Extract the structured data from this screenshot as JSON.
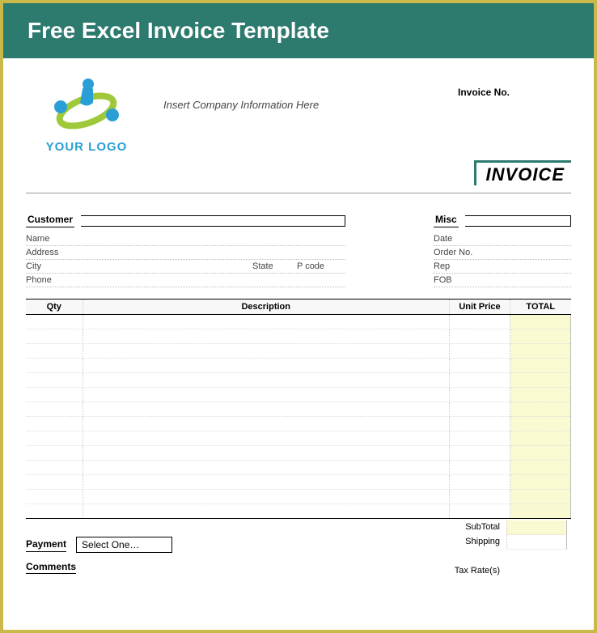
{
  "header": {
    "title": "Free Excel Invoice Template"
  },
  "top": {
    "logoText": "YOUR LOGO",
    "companyPlaceholder": "Insert Company Information Here",
    "invoiceNoLabel": "Invoice No.",
    "invoiceTitle": "INVOICE"
  },
  "customer": {
    "header": "Customer",
    "name": "Name",
    "address": "Address",
    "city": "City",
    "state": "State",
    "pcode": "P code",
    "phone": "Phone"
  },
  "misc": {
    "header": "Misc",
    "date": "Date",
    "orderNo": "Order No.",
    "rep": "Rep",
    "fob": "FOB"
  },
  "table": {
    "qty": "Qty",
    "description": "Description",
    "unitPrice": "Unit Price",
    "total": "TOTAL"
  },
  "totals": {
    "subtotal": "SubTotal",
    "shipping": "Shipping",
    "taxRates": "Tax Rate(s)"
  },
  "payment": {
    "label": "Payment",
    "selectText": "Select One…",
    "commentsLabel": "Comments"
  }
}
